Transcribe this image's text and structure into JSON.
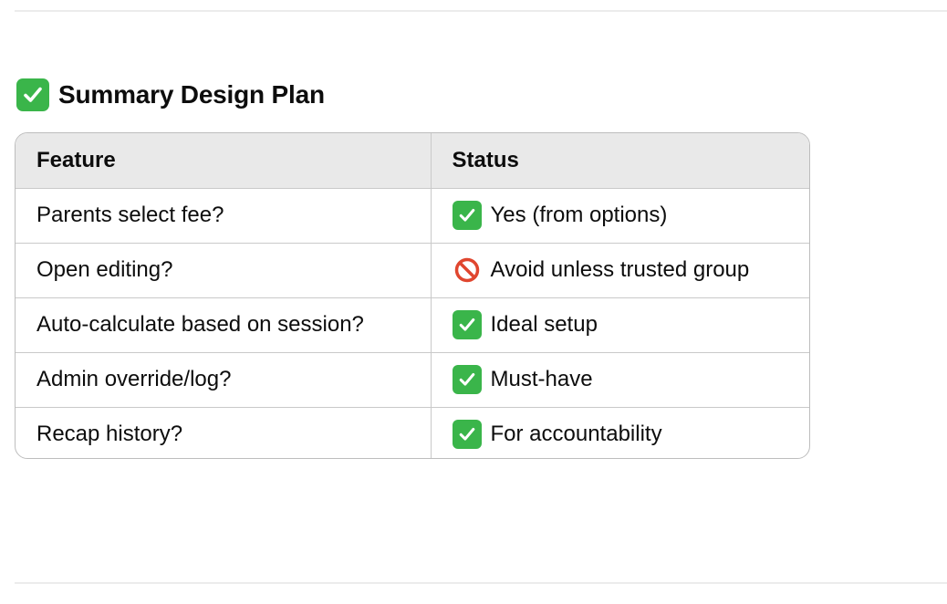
{
  "heading": {
    "icon": "check-mark-button-icon",
    "text": "Summary Design Plan"
  },
  "table": {
    "headers": [
      "Feature",
      "Status"
    ],
    "rows": [
      {
        "feature": "Parents select fee?",
        "status_icon": "check-mark-button-icon",
        "status": "Yes (from options)"
      },
      {
        "feature": "Open editing?",
        "status_icon": "prohibited-icon",
        "status": "Avoid unless trusted group"
      },
      {
        "feature": "Auto-calculate based on session?",
        "status_icon": "check-mark-button-icon",
        "status": "Ideal setup"
      },
      {
        "feature": "Admin override/log?",
        "status_icon": "check-mark-button-icon",
        "status": "Must-have"
      },
      {
        "feature": "Recap history?",
        "status_icon": "check-mark-button-icon",
        "status": "For accountability"
      }
    ]
  },
  "colors": {
    "check_green": "#3ab54a",
    "prohibit_red": "#e0462f",
    "header_bg": "#e9e9e9",
    "border": "#c9c9c9"
  }
}
